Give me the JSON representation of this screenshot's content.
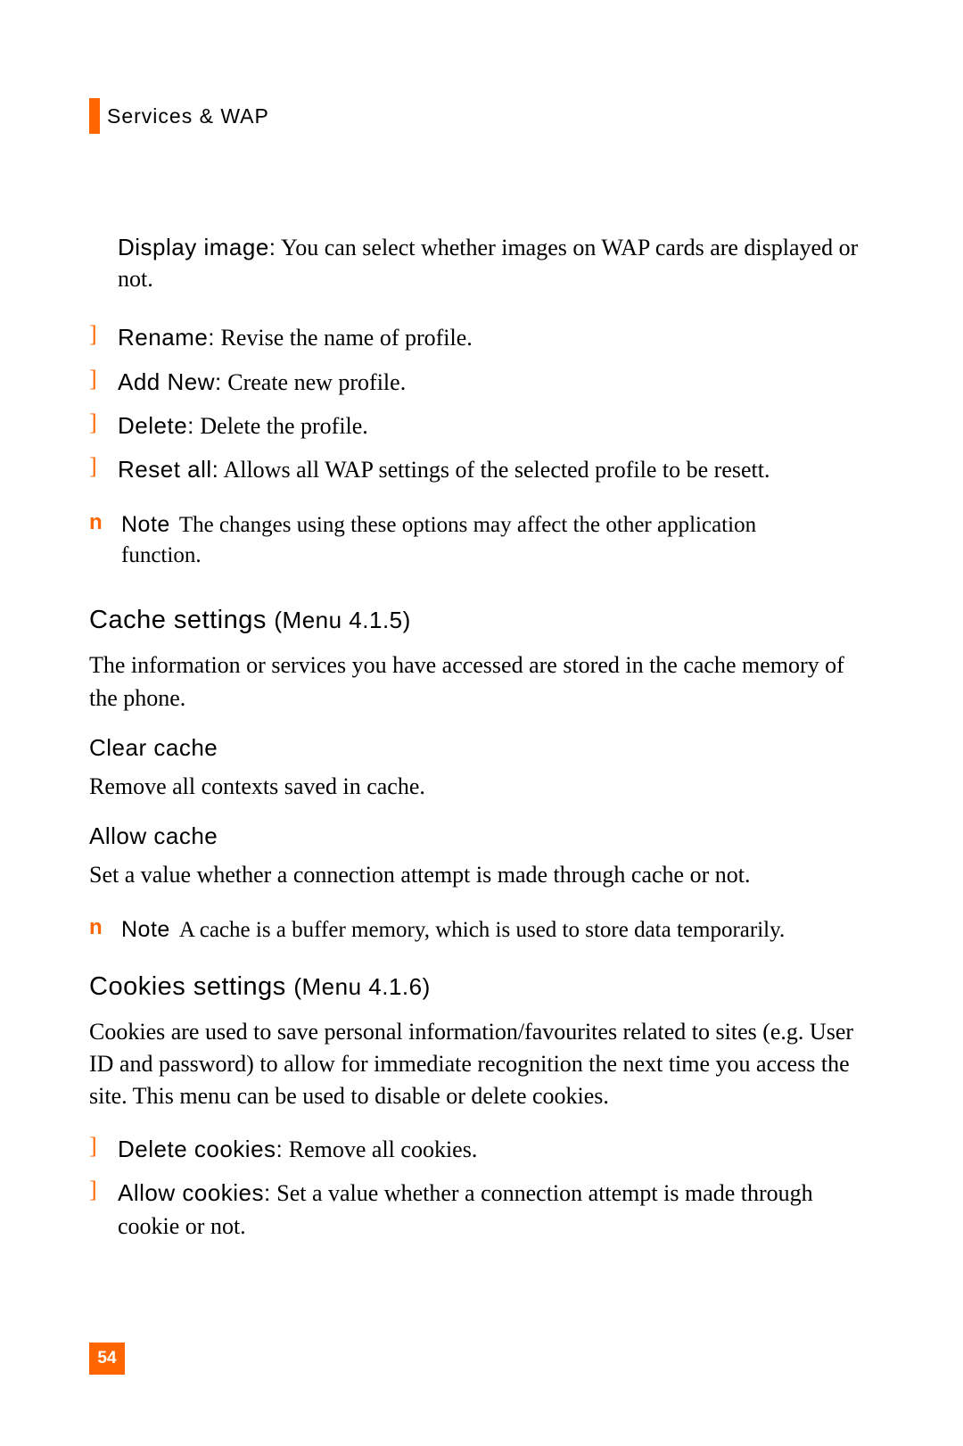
{
  "header": {
    "title": "Services & WAP"
  },
  "display_image": {
    "label": "Display image:",
    "text": " You can select whether images on WAP cards are displayed or not."
  },
  "profile_items": [
    {
      "label": "Rename:",
      "text": " Revise the name of profile."
    },
    {
      "label": "Add New:",
      "text": " Create new profile."
    },
    {
      "label": "Delete:",
      "text": " Delete the profile."
    },
    {
      "label": "Reset all:",
      "text": " Allows all WAP settings of the selected profile to be resett."
    }
  ],
  "note1": {
    "marker": "n",
    "label": "Note",
    "text": "The changes using these options may affect the other application function."
  },
  "cache_section": {
    "heading": "Cache settings",
    "menu_ref": "(Menu 4.1.5)",
    "intro": "The information or services you have accessed are stored in the cache memory of the phone.",
    "sub1_heading": "Clear cache",
    "sub1_text": "Remove all contexts saved in cache.",
    "sub2_heading": "Allow cache",
    "sub2_text": "Set a value whether a connection attempt is made through cache or not."
  },
  "note2": {
    "marker": "n",
    "label": "Note",
    "text": "A cache is a buffer memory, which is used to store data temporarily."
  },
  "cookies_section": {
    "heading": "Cookies settings",
    "menu_ref": "(Menu 4.1.6)",
    "intro": "Cookies are used to save personal information/favourites related to sites (e.g. User ID and password) to allow for immediate recognition the next time you access the site. This menu can be used to disable or delete cookies.",
    "items": [
      {
        "label": "Delete cookies:",
        "text": " Remove all cookies."
      },
      {
        "label": "Allow cookies:",
        "text": " Set a value whether a connection attempt is made through cookie or not."
      }
    ]
  },
  "page_number": "54",
  "bullet_char": "]"
}
